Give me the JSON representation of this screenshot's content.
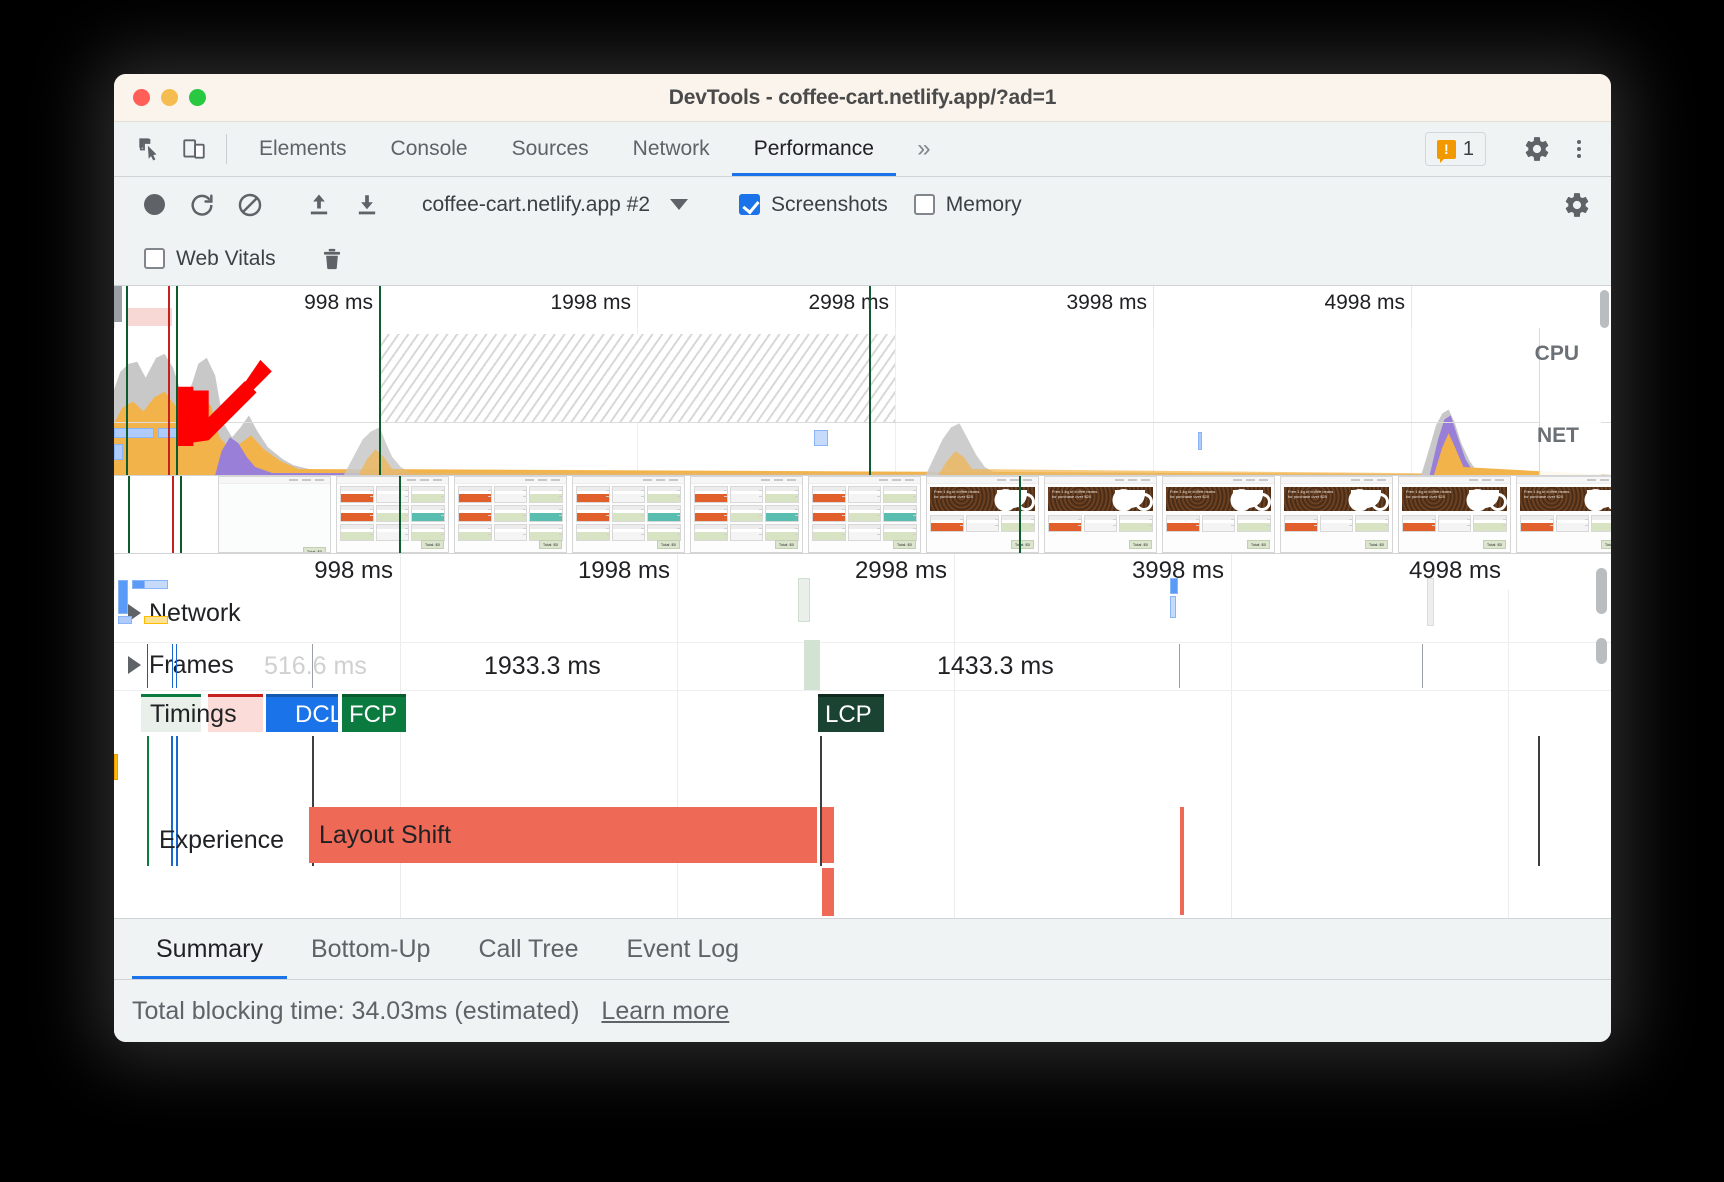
{
  "window": {
    "title": "DevTools - coffee-cart.netlify.app/?ad=1",
    "traffic_lights": [
      "close",
      "minimize",
      "maximize"
    ]
  },
  "tabstrip": {
    "icons": [
      "inspect-element-icon",
      "device-toolbar-icon"
    ],
    "tabs": [
      {
        "label": "Elements",
        "active": false
      },
      {
        "label": "Console",
        "active": false
      },
      {
        "label": "Sources",
        "active": false
      },
      {
        "label": "Network",
        "active": false
      },
      {
        "label": "Performance",
        "active": true
      }
    ],
    "more_tabs_glyph": "»",
    "warning_count": "1",
    "settings_icon": "gear-icon",
    "kebab_icon": "more-options-icon"
  },
  "perf_toolbar": {
    "record_label": "record-button",
    "reload_label": "reload-and-record-button",
    "clear_label": "clear-button",
    "upload_label": "load-profile-button",
    "download_label": "save-profile-button",
    "session_name": "coffee-cart.netlify.app #2",
    "session_caret": "▼",
    "screenshots": {
      "label": "Screenshots",
      "checked": true
    },
    "memory": {
      "label": "Memory",
      "checked": false
    },
    "web_vitals": {
      "label": "Web Vitals",
      "checked": false
    },
    "trash_icon": "trash-icon",
    "capture_settings_icon": "gear-icon"
  },
  "overview": {
    "ticks": [
      "998 ms",
      "1998 ms",
      "2998 ms",
      "3998 ms",
      "4998 ms"
    ],
    "cpu_label": "CPU",
    "net_label": "NET"
  },
  "flame_chart": {
    "ticks": [
      "998 ms",
      "1998 ms",
      "2998 ms",
      "3998 ms",
      "4998 ms"
    ],
    "tracks": [
      {
        "name": "Network",
        "expandable": true
      },
      {
        "name": "Frames",
        "expandable": true
      },
      {
        "name": "Timings",
        "expandable": false
      },
      {
        "name": "Experience",
        "expandable": false
      }
    ],
    "frame_durations": [
      {
        "label": "516.6 ms",
        "faded": true
      },
      {
        "label": "1933.3 ms",
        "faded": false
      },
      {
        "label": "1433.3 ms",
        "faded": false
      }
    ],
    "timing_markers": [
      {
        "label": "DCL",
        "style": "blue"
      },
      {
        "label": "FCP",
        "style": "green"
      },
      {
        "label": "LCP",
        "style": "darkgreen"
      }
    ],
    "experience_event": "Layout Shift"
  },
  "bottom_tabs": [
    {
      "label": "Summary",
      "active": true
    },
    {
      "label": "Bottom-Up",
      "active": false
    },
    {
      "label": "Call Tree",
      "active": false
    },
    {
      "label": "Event Log",
      "active": false
    }
  ],
  "summary": {
    "text": "Total blocking time: 34.03ms (estimated)",
    "link": "Learn more"
  },
  "filmstrip": {
    "banner_text": "Free 1 kg of coffee beans for purchase over $20",
    "cart_button": "Total: $0",
    "frame_count": 13
  },
  "annotation": {
    "arrow": "red-arrow-pointing-down-left",
    "color": "#ff0000"
  },
  "colors": {
    "accent": "#1a73e8",
    "titlebar": "#faf4ec",
    "toolbar": "#eff3f4",
    "layout_shift": "#ef6a56",
    "fcp_green": "#0b7a3e",
    "lcp_green": "#1b4332",
    "warning_orange": "#f29900"
  }
}
